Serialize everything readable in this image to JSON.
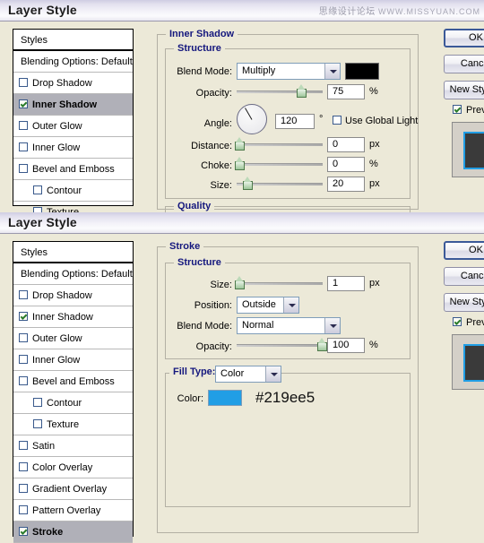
{
  "watermark": {
    "cn": "思缘设计论坛",
    "url": "WWW.MISSYUAN.COM"
  },
  "buttons": {
    "ok": "OK",
    "cancel": "Cancel",
    "new_style": "New Style...",
    "preview": "Preview"
  },
  "styles_list": {
    "styles_label": "Styles",
    "blending_options": "Blending Options: Default",
    "items": [
      {
        "label": "Drop Shadow",
        "checked": false,
        "sub": false
      },
      {
        "label": "Inner Shadow",
        "checked": true,
        "sub": false
      },
      {
        "label": "Outer Glow",
        "checked": false,
        "sub": false
      },
      {
        "label": "Inner Glow",
        "checked": false,
        "sub": false
      },
      {
        "label": "Bevel and Emboss",
        "checked": false,
        "sub": false
      },
      {
        "label": "Contour",
        "checked": false,
        "sub": true
      },
      {
        "label": "Texture",
        "checked": false,
        "sub": true
      },
      {
        "label": "Satin",
        "checked": false,
        "sub": false
      },
      {
        "label": "Color Overlay",
        "checked": false,
        "sub": false
      },
      {
        "label": "Gradient Overlay",
        "checked": false,
        "sub": false
      },
      {
        "label": "Pattern Overlay",
        "checked": false,
        "sub": false
      },
      {
        "label": "Stroke",
        "checked": true,
        "sub": false
      }
    ]
  },
  "panel1": {
    "title": "Layer Style",
    "section_title": "Inner Shadow",
    "structure_title": "Structure",
    "quality_title": "Quality",
    "blend_mode_label": "Blend Mode:",
    "blend_mode_value": "Multiply",
    "blend_color": "#000000",
    "opacity_label": "Opacity:",
    "opacity_value": "75",
    "opacity_unit": "%",
    "angle_label": "Angle:",
    "angle_value": "120",
    "angle_unit": "°",
    "use_global_light": "Use Global Light",
    "distance_label": "Distance:",
    "distance_value": "0",
    "distance_unit": "px",
    "choke_label": "Choke:",
    "choke_value": "0",
    "choke_unit": "%",
    "size_label": "Size:",
    "size_value": "20",
    "size_unit": "px",
    "selected_style": "Inner Shadow"
  },
  "panel2": {
    "title": "Layer Style",
    "section_title": "Stroke",
    "structure_title": "Structure",
    "size_label": "Size:",
    "size_value": "1",
    "size_unit": "px",
    "position_label": "Position:",
    "position_value": "Outside",
    "blend_mode_label": "Blend Mode:",
    "blend_mode_value": "Normal",
    "opacity_label": "Opacity:",
    "opacity_value": "100",
    "opacity_unit": "%",
    "fill_type_label": "Fill Type:",
    "fill_type_value": "Color",
    "color_label": "Color:",
    "color_value": "#219ee5",
    "color_hex_text": "#219ee5",
    "selected_style": "Stroke"
  }
}
